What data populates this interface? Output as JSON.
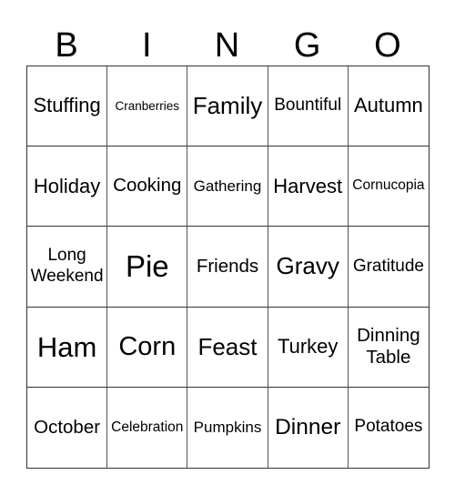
{
  "header": {
    "letters": [
      "B",
      "I",
      "N",
      "G",
      "O"
    ]
  },
  "grid": {
    "rows": [
      [
        "Stuffing",
        "Cranberries",
        "Family",
        "Bountiful",
        "Autumn"
      ],
      [
        "Holiday",
        "Cooking",
        "Gathering",
        "Harvest",
        "Cornucopia"
      ],
      [
        "Long Weekend",
        "Pie",
        "Friends",
        "Gravy",
        "Gratitude"
      ],
      [
        "Ham",
        "Corn",
        "Feast",
        "Turkey",
        "Dinning Table"
      ],
      [
        "October",
        "Celebration",
        "Pumpkins",
        "Dinner",
        "Potatoes"
      ]
    ]
  }
}
